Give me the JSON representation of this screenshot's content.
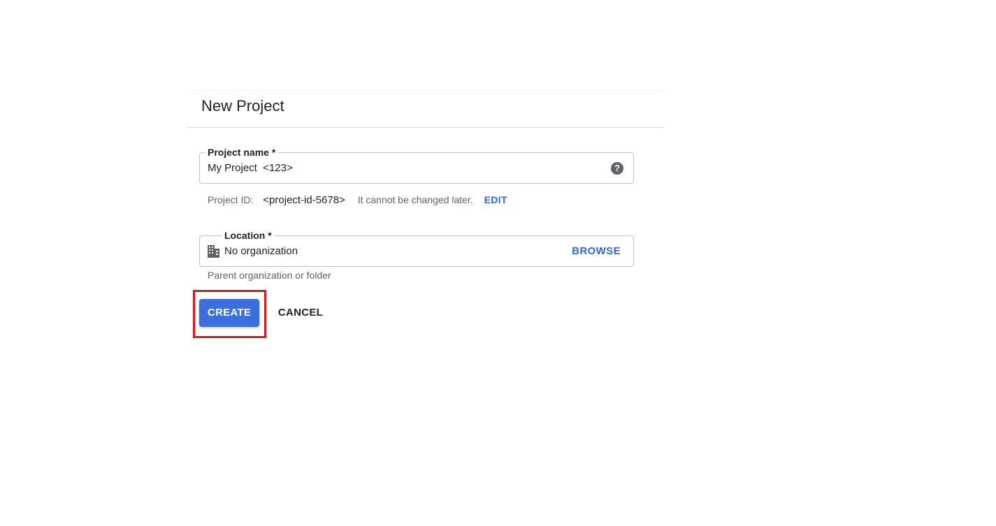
{
  "dialog": {
    "title": "New Project"
  },
  "project_name": {
    "label": "Project name *",
    "value": "My Project  <123>",
    "help_icon": "help-circle-icon"
  },
  "project_id": {
    "label": "Project ID:",
    "value": "<project-id-5678>",
    "note": "It cannot be changed later.",
    "edit_label": "EDIT"
  },
  "location": {
    "label": "Location *",
    "icon": "building-icon",
    "value": "No organization",
    "browse_label": "BROWSE",
    "helper": "Parent organization or folder"
  },
  "actions": {
    "create_label": "CREATE",
    "cancel_label": "CANCEL"
  },
  "colors": {
    "accent": "#3367d6",
    "primary_button": "#3b6fe0",
    "highlight": "#e0161e"
  }
}
